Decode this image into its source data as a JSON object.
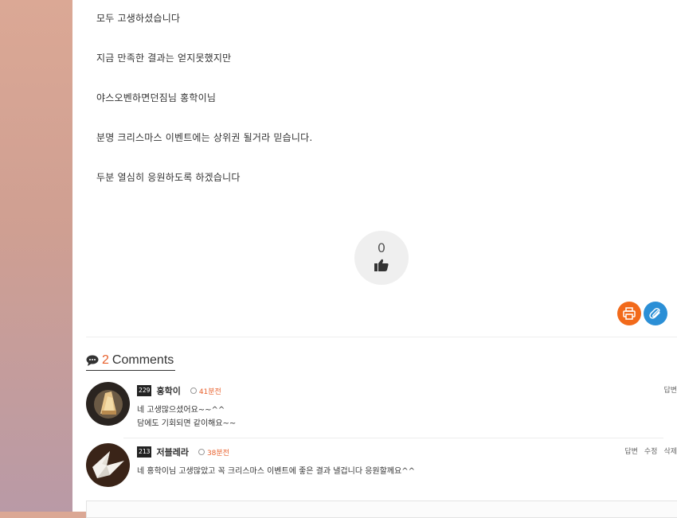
{
  "post": {
    "lines": [
      "모두 고생하셨습니다",
      "지금 만족한 결과는 얻지못했지만",
      "야스오벤하면던짐님 홍학이님",
      "분명 크리스마스 이벤트에는 상위권 될거라 믿습니다.",
      "두분 열심히 응원하도록 하겠습니다"
    ],
    "like_count": "0"
  },
  "actions": {
    "print_icon": "print-icon",
    "attach_icon": "paperclip-icon"
  },
  "comments_header": {
    "count": "2",
    "label": "Comments"
  },
  "comments": [
    {
      "level": "229",
      "author": "홍학이",
      "time": "41분전",
      "actions": [
        "답변"
      ],
      "lines": [
        "네 고생많으셨어요~~^^",
        "담에도 기회되면 같이해요~~"
      ]
    },
    {
      "level": "213",
      "author": "저블레라",
      "time": "38분전",
      "actions": [
        "답변",
        "수정",
        "삭제"
      ],
      "lines": [
        "네 홍학이님 고생많았고 꼭 크리스마스 이벤트에 좋은 결과 낼겁니다 응원할께요^^"
      ]
    }
  ],
  "colors": {
    "accent": "#e8602c",
    "print": "#f26a1b",
    "attach": "#2b8fd6"
  }
}
